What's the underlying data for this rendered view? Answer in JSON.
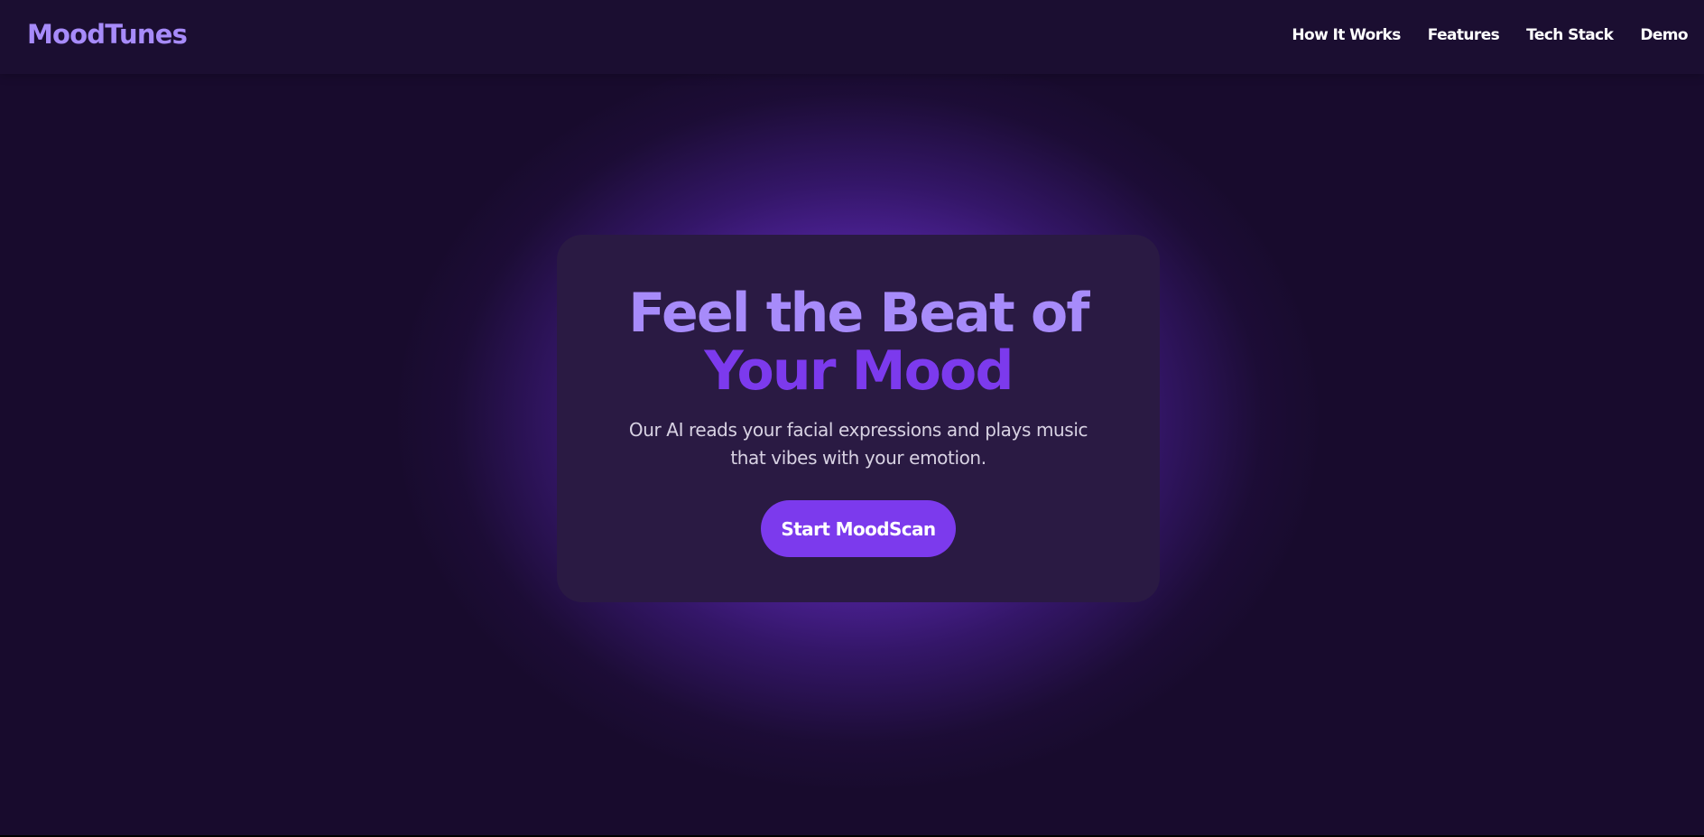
{
  "brand": {
    "name": "MoodTunes",
    "accent": "#a78bfa",
    "primary": "#7c3aed",
    "background": "#180b2d"
  },
  "nav": {
    "links": [
      {
        "label": "How It Works"
      },
      {
        "label": "Features"
      },
      {
        "label": "Tech Stack"
      },
      {
        "label": "Demo"
      }
    ]
  },
  "hero": {
    "headline_line1": "Feel the Beat of",
    "headline_line2": "Your Mood",
    "subtitle": "Our AI reads your facial expressions and plays music that vibes with your emotion.",
    "cta_label": "Start MoodScan"
  }
}
